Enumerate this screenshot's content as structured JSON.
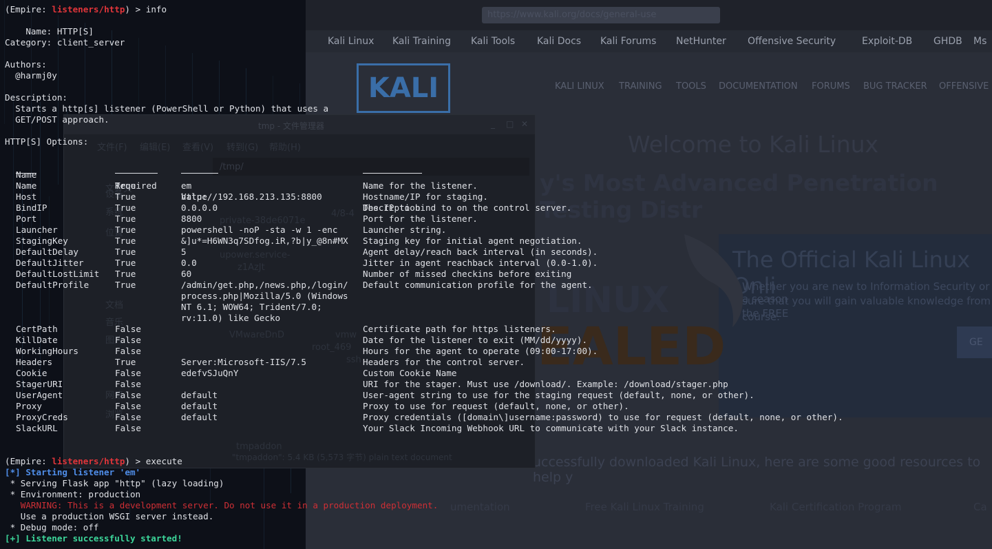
{
  "background": {
    "browser": {
      "url_text": "https://www.kali.org/docs/general-use",
      "bookmarks": [
        "Kali Linux",
        "Kali Training",
        "Kali Tools",
        "Kali Docs",
        "Kali Forums",
        "NetHunter",
        "Offensive Security",
        "Exploit-DB",
        "GHDB",
        "Ms"
      ],
      "logo_text": "KALI",
      "nav": [
        "KALI LINUX",
        "TRAINING",
        "TOOLS",
        "DOCUMENTATION",
        "FORUMS",
        "BUG TRACKER",
        "OFFENSIVE"
      ],
      "hero_title": "Welcome to Kali Linux",
      "hero_subtitle": "y's Most Advanced Penetration Testing Distr",
      "promo_title": "The Official Kali Linux Onli",
      "promo_line1": "Whether you are new to Information Security or a season",
      "promo_line2": "sure that you will gain valuable knowledge from the FREE",
      "promo_line3": "course.",
      "promo_button": "GE",
      "linux_text": "LINUX",
      "ealed_text": "EALED",
      "bottom_message": "uccessfully downloaded Kali Linux, here are some good resources to help y",
      "footer_links": [
        "umentation",
        "Free Kali Linux Training",
        "Kali Certification Program",
        "Ca"
      ]
    },
    "file_manager": {
      "title": "tmp - 文件管理器",
      "menu": [
        "文件(F)",
        "编辑(E)",
        "查看(V)",
        "转到(G)",
        "帮助(H)"
      ],
      "path": "/tmp/",
      "sidebar": [
        "文件夹",
        "设备",
        "系统",
        "位置",
        "文档",
        "音乐",
        "图片",
        "网络",
        "浏览"
      ],
      "files": [
        "private-38de6071e",
        "upower.service-",
        "VMwareDnD",
        "tmpaddon",
        "vmw",
        "root_469",
        "4/8-4",
        "z1AzJt",
        "ssh"
      ],
      "status": "\"tmpaddon\": 5.4 KB (5,573 字节) plain text document"
    }
  },
  "terminal": {
    "prompt_prefix": "(Empire: ",
    "prompt_module": "listeners/http",
    "prompt_suffix": ") > ",
    "command_info": "info",
    "command_execute": "execute",
    "info_header": {
      "name_line": "    Name: HTTP[S]",
      "category_line": "Category: client_server",
      "authors_label": "Authors:",
      "author": "  @harmj0y",
      "description_label": "Description:",
      "description_line1": "  Starts a http[s] listener (PowerShell or Python) that uses a",
      "description_line2": "  GET/POST approach.",
      "options_label": "HTTP[S] Options:"
    },
    "table_headers": {
      "name": "Name",
      "required": "Required",
      "value": "Value",
      "description": "Description"
    },
    "options": [
      {
        "name": "Name",
        "required": "True",
        "value": "em",
        "description": "Name for the listener."
      },
      {
        "name": "Host",
        "required": "True",
        "value": "http://192.168.213.135:8800",
        "description": "Hostname/IP for staging."
      },
      {
        "name": "BindIP",
        "required": "True",
        "value": "0.0.0.0",
        "description": "The IP to bind to on the control server."
      },
      {
        "name": "Port",
        "required": "True",
        "value": "8800",
        "description": "Port for the listener."
      },
      {
        "name": "Launcher",
        "required": "True",
        "value": "powershell -noP -sta -w 1 -enc",
        "description": "Launcher string."
      },
      {
        "name": "StagingKey",
        "required": "True",
        "value": "&]u*=H6WN3q7SDfog.iR,?b|y_@8n#MX",
        "description": "Staging key for initial agent negotiation."
      },
      {
        "name": "DefaultDelay",
        "required": "True",
        "value": "5",
        "description": "Agent delay/reach back interval (in seconds)."
      },
      {
        "name": "DefaultJitter",
        "required": "True",
        "value": "0.0",
        "description": "Jitter in agent reachback interval (0.0-1.0)."
      },
      {
        "name": "DefaultLostLimit",
        "required": "True",
        "value": "60",
        "description": "Number of missed checkins before exiting"
      },
      {
        "name": "DefaultProfile",
        "required": "True",
        "value": "/admin/get.php,/news.php,/login/",
        "description": "Default communication profile for the agent."
      },
      {
        "name": "",
        "required": "",
        "value": "process.php|Mozilla/5.0 (Windows",
        "description": ""
      },
      {
        "name": "",
        "required": "",
        "value": "NT 6.1; WOW64; Trident/7.0;",
        "description": ""
      },
      {
        "name": "",
        "required": "",
        "value": "rv:11.0) like Gecko",
        "description": ""
      },
      {
        "name": "CertPath",
        "required": "False",
        "value": "",
        "description": "Certificate path for https listeners."
      },
      {
        "name": "KillDate",
        "required": "False",
        "value": "",
        "description": "Date for the listener to exit (MM/dd/yyyy)."
      },
      {
        "name": "WorkingHours",
        "required": "False",
        "value": "",
        "description": "Hours for the agent to operate (09:00-17:00)."
      },
      {
        "name": "Headers",
        "required": "True",
        "value": "Server:Microsoft-IIS/7.5",
        "description": "Headers for the control server."
      },
      {
        "name": "Cookie",
        "required": "False",
        "value": "edefvSJuQnY",
        "description": "Custom Cookie Name"
      },
      {
        "name": "StagerURI",
        "required": "False",
        "value": "",
        "description": "URI for the stager. Must use /download/. Example: /download/stager.php"
      },
      {
        "name": "UserAgent",
        "required": "False",
        "value": "default",
        "description": "User-agent string to use for the staging request (default, none, or other)."
      },
      {
        "name": "Proxy",
        "required": "False",
        "value": "default",
        "description": "Proxy to use for request (default, none, or other)."
      },
      {
        "name": "ProxyCreds",
        "required": "False",
        "value": "default",
        "description": "Proxy credentials ([domain\\]username:password) to use for request (default, none, or other)."
      },
      {
        "name": "SlackURL",
        "required": "False",
        "value": "",
        "description": "Your Slack Incoming Webhook URL to communicate with your Slack instance."
      }
    ],
    "execute_output": {
      "starting": "[*] Starting listener 'em'",
      "serving": " * Serving Flask app \"http\" (lazy loading)",
      "environment": " * Environment: production",
      "warning": "   WARNING: This is a development server. Do not use it in a production deployment.",
      "use_wsgi": "   Use a production WSGI server instead.",
      "debug": " * Debug mode: off",
      "success": "[+] Listener successfully started!"
    },
    "colors": {
      "text": "#dfe1e6",
      "module_red": "#e0353a",
      "info_blue": "#4f8de8",
      "success_green": "#3cd69a",
      "warning_red": "#cf2f35"
    }
  }
}
